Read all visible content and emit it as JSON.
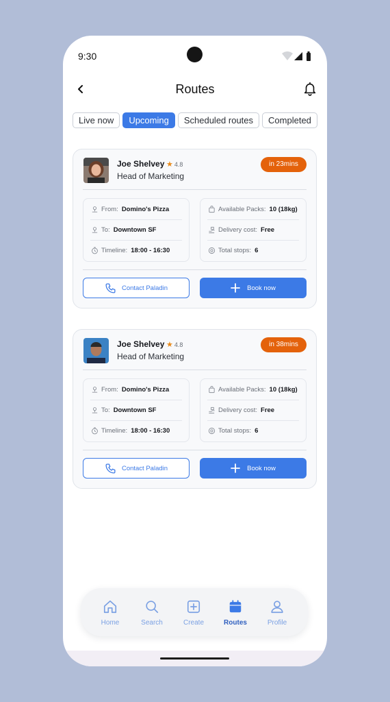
{
  "status_bar": {
    "time": "9:30"
  },
  "header": {
    "title": "Routes"
  },
  "tabs": [
    {
      "label": "Live now",
      "active": false
    },
    {
      "label": "Upcoming",
      "active": true
    },
    {
      "label": "Scheduled routes",
      "active": false
    },
    {
      "label": "Completed",
      "active": false
    }
  ],
  "routes": [
    {
      "driver_name": "Joe Shelvey",
      "rating": "4.8",
      "role": "Head of Marketing",
      "eta": "in 23mins",
      "from_label": "From:",
      "from_value": "Domino's Pizza",
      "to_label": "To:",
      "to_value": "Downtown SF",
      "timeline_label": "Timeline:",
      "timeline_value": "18:00 - 16:30",
      "packs_label": "Available Packs:",
      "packs_value": "10 (18kg)",
      "cost_label": "Delivery cost:",
      "cost_value": "Free",
      "stops_label": "Total stops:",
      "stops_value": "6",
      "contact_label": "Contact Paladin",
      "book_label": "Book now"
    },
    {
      "driver_name": "Joe Shelvey",
      "rating": "4.8",
      "role": "Head of Marketing",
      "eta": "in 38mins",
      "from_label": "From:",
      "from_value": "Domino's Pizza",
      "to_label": "To:",
      "to_value": "Downtown SF",
      "timeline_label": "Timeline:",
      "timeline_value": "18:00 - 16:30",
      "packs_label": "Available Packs:",
      "packs_value": "10 (18kg)",
      "cost_label": "Delivery cost:",
      "cost_value": "Free",
      "stops_label": "Total stops:",
      "stops_value": "6",
      "contact_label": "Contact Paladin",
      "book_label": "Book now"
    }
  ],
  "bottom_nav": [
    {
      "label": "Home",
      "icon": "home-icon",
      "active": false
    },
    {
      "label": "Search",
      "icon": "search-icon",
      "active": false
    },
    {
      "label": "Create",
      "icon": "plus-square-icon",
      "active": false
    },
    {
      "label": "Routes",
      "icon": "calendar-icon",
      "active": true
    },
    {
      "label": "Profile",
      "icon": "user-icon",
      "active": false
    }
  ],
  "colors": {
    "background": "#b1bdd7",
    "accent": "#3c7ae6",
    "eta_badge": "#e4620b",
    "star": "#e88a1a",
    "nav_inactive": "#7aa0e3",
    "nav_active": "#2f5fbf"
  }
}
